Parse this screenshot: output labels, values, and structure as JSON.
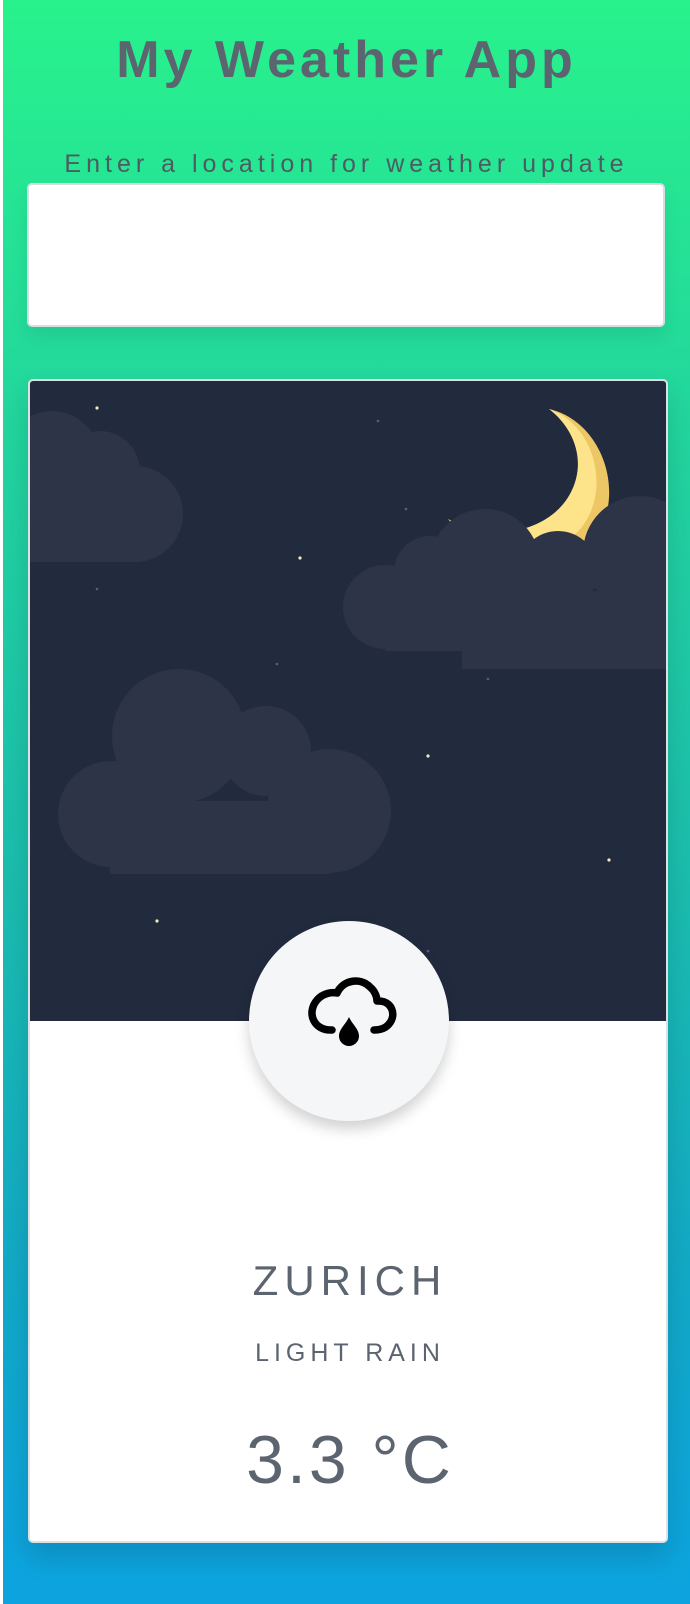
{
  "app": {
    "title": "My Weather App",
    "search_prompt": "Enter a location for weather update",
    "search_value": "",
    "search_placeholder": ""
  },
  "weather": {
    "city": "ZURICH",
    "condition": "LIGHT RAIN",
    "temperature": "3.3 °C",
    "icon": "cloud-rain-icon",
    "scene": "night-moon-clouds"
  },
  "colors": {
    "gradient_top": "#28f28c",
    "gradient_bottom": "#0ca3e0",
    "night_sky": "#222a3e",
    "moon": "#fde38a",
    "text": "#5c6470"
  }
}
